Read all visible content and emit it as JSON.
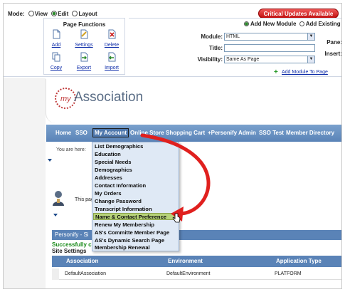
{
  "control_panel": {
    "mode": {
      "label": "Mode:",
      "options": [
        "View",
        "Edit",
        "Layout"
      ],
      "selected": "Edit"
    },
    "critical_updates_label": "Critical Updates Available",
    "page_functions": {
      "title": "Page Functions",
      "items": [
        {
          "label": "Add",
          "icon": "add-page-icon"
        },
        {
          "label": "Settings",
          "icon": "settings-icon"
        },
        {
          "label": "Delete",
          "icon": "delete-icon"
        },
        {
          "label": "Copy",
          "icon": "copy-icon"
        },
        {
          "label": "Export",
          "icon": "export-icon"
        },
        {
          "label": "Import",
          "icon": "import-icon"
        }
      ]
    },
    "module": {
      "add_new_label": "Add New Module",
      "add_existing_label": "Add Existing M",
      "module_label": "Module:",
      "module_value": "HTML",
      "title_label": "Title:",
      "title_value": "",
      "visibility_label": "Visibility:",
      "visibility_value": "Same As Page",
      "pane_label": "Pane:",
      "insert_label": "Insert:",
      "add_module_link": "Add Module To Page"
    }
  },
  "logo": {
    "my": "my",
    "name": "Association"
  },
  "nav": {
    "items": [
      "Home",
      "SSO",
      "My Account",
      "Online Store",
      "Shopping Cart",
      "+Personify Admin",
      "SSO Test",
      "Member Directory"
    ],
    "active": "My Account"
  },
  "content": {
    "you_are_here": "You are here:",
    "this_page": "This pag",
    "personify_bar": "Personify - Si",
    "success": "Successfully c",
    "site_settings": "Site Settings",
    "table": {
      "columns": [
        "Association",
        "Environment",
        "Application Type"
      ],
      "rows": [
        [
          "DefaultAssociation",
          "DefaultEnvironment",
          "PLATFORM"
        ]
      ]
    }
  },
  "dropdown": {
    "items": [
      "List Demographics",
      "Education",
      "Special Needs",
      "Demographics",
      "Addresses",
      "Contact Information",
      "My Orders",
      "Change Password",
      "Transcript Information",
      "Name & Contact Preference",
      "Renew My Membership",
      "AS's Committe Member Page",
      "AS's Dynamic Search Page",
      "Membership Renewal"
    ],
    "highlighted": "Name & Contact Preference"
  },
  "colors": {
    "nav_blue": "#5a83b7",
    "highlight_green": "#b7d37a",
    "arrow_red": "#e0201e",
    "critical_red": "#c10f0f"
  }
}
